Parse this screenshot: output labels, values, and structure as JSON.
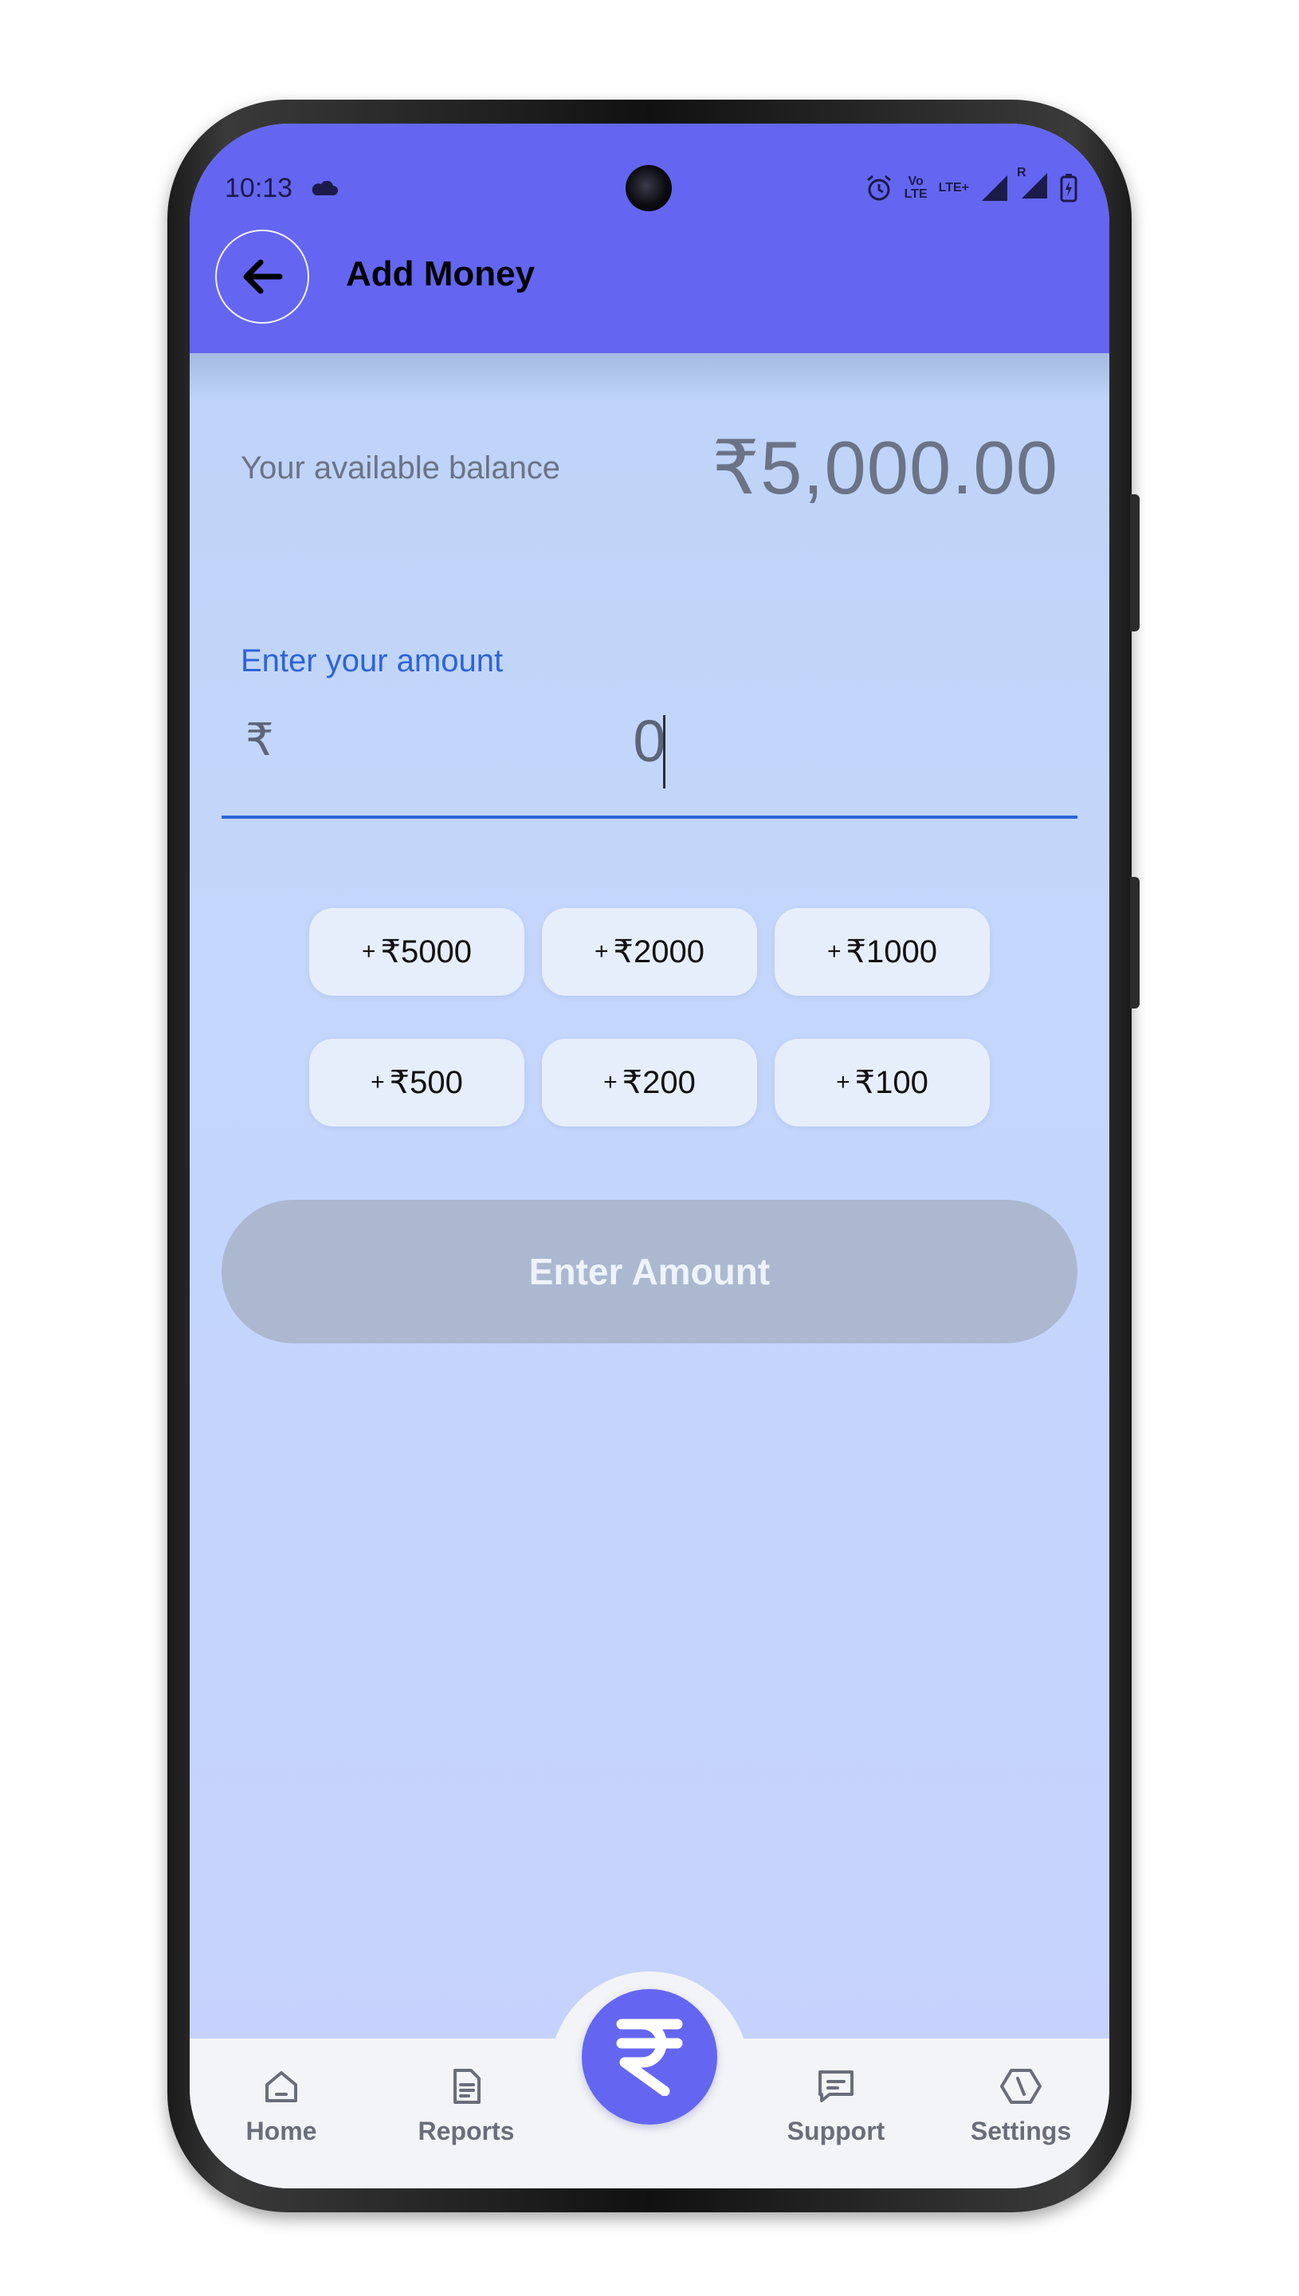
{
  "status_bar": {
    "time": "10:13",
    "network_label_top": "Vo",
    "network_label_bottom": "LTE",
    "lte_label": "LTE+",
    "roaming_label": "R"
  },
  "header": {
    "title": "Add Money"
  },
  "balance": {
    "label": "Your available balance",
    "value": "₹5,000.00"
  },
  "amount": {
    "label": "Enter your amount",
    "currency_symbol": "₹",
    "value": "0"
  },
  "quick_amounts": [
    {
      "label": "₹5000"
    },
    {
      "label": "₹2000"
    },
    {
      "label": "₹1000"
    },
    {
      "label": "₹500"
    },
    {
      "label": "₹200"
    },
    {
      "label": "₹100"
    }
  ],
  "quick_amount_prefix": "+",
  "submit_button": {
    "label": "Enter Amount"
  },
  "bottom_nav": {
    "items": [
      {
        "label": "Home"
      },
      {
        "label": "Reports"
      },
      {
        "label": "Support"
      },
      {
        "label": "Settings"
      }
    ]
  },
  "colors": {
    "primary": "#6466f1",
    "accent_blue": "#2e63d8",
    "disabled_button": "#abb8d0"
  }
}
